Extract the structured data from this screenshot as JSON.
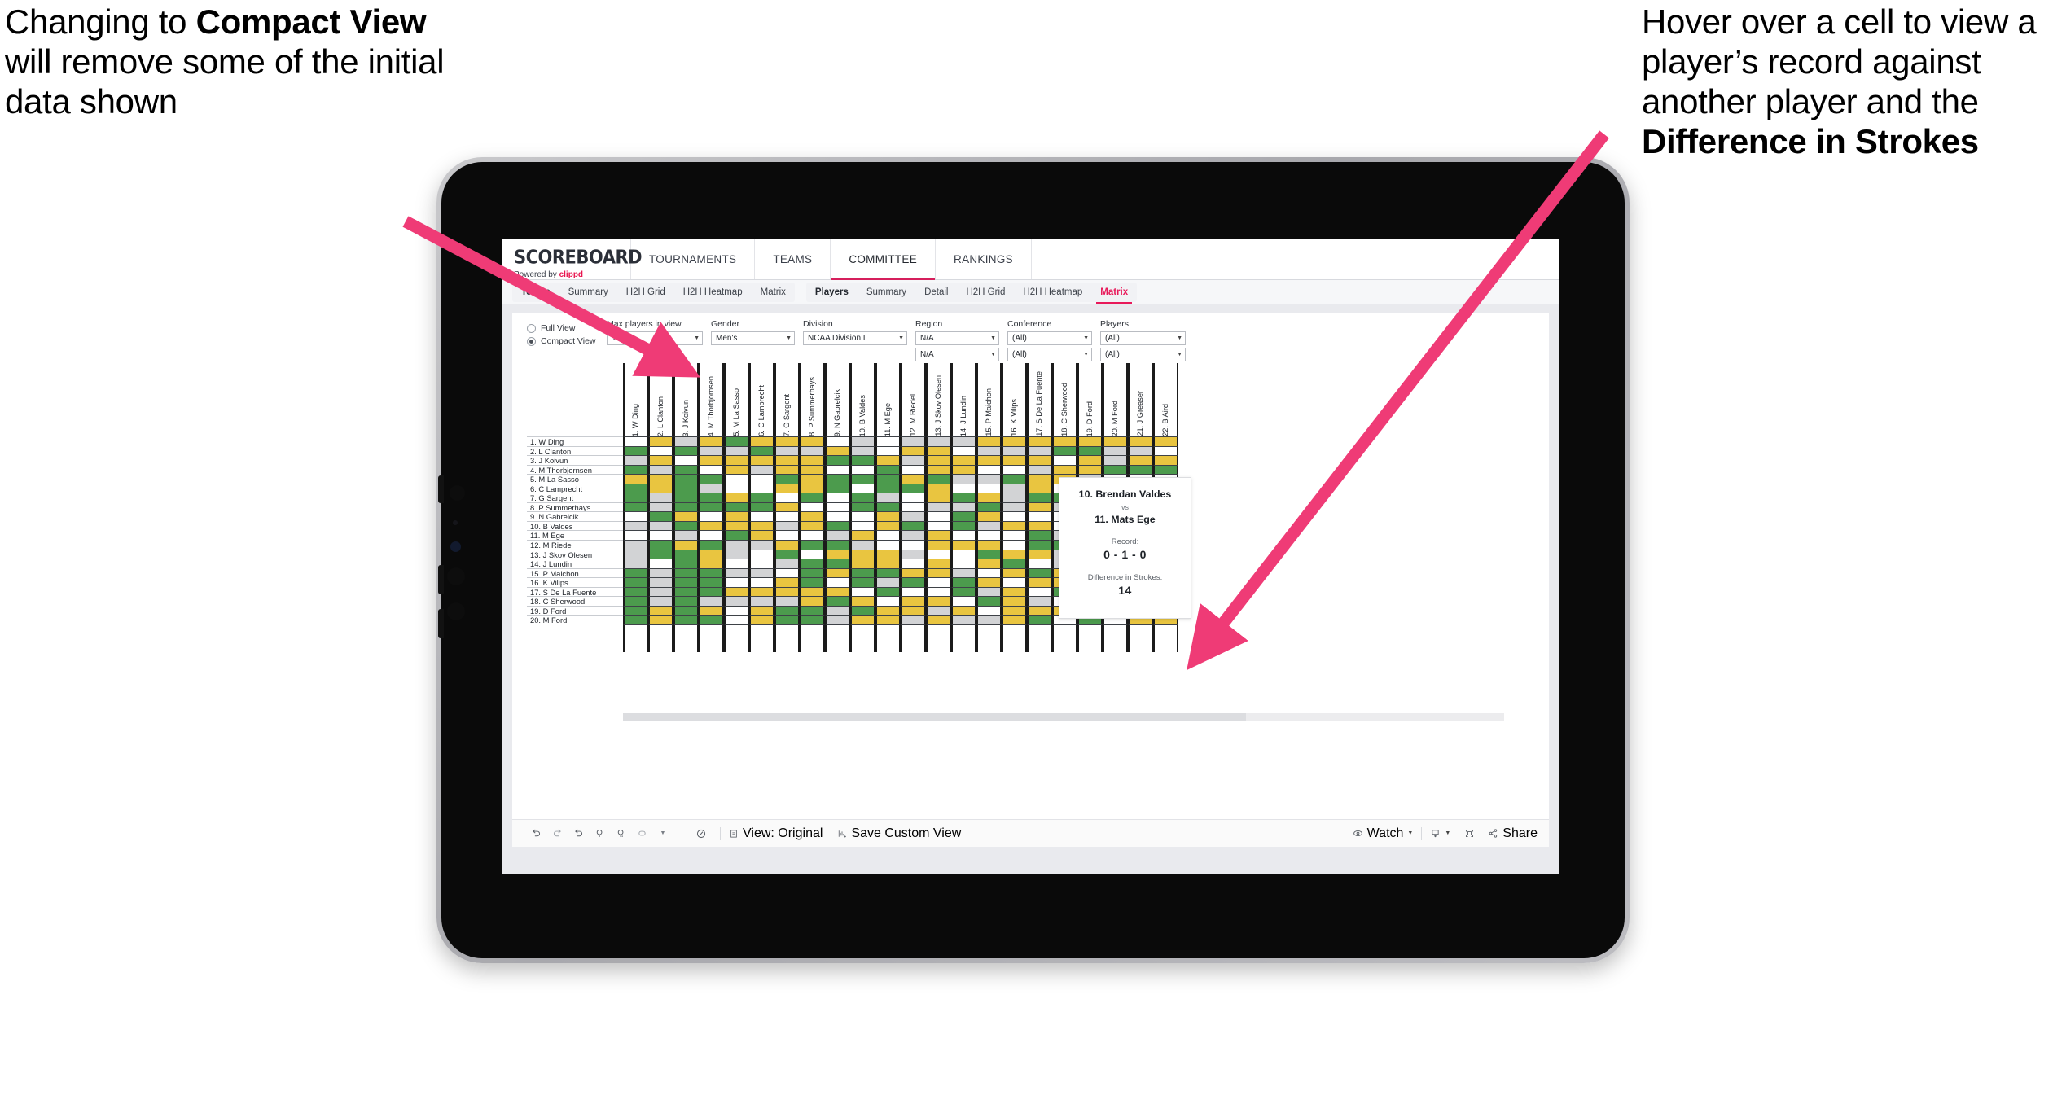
{
  "annotations": {
    "left": {
      "pre": "Changing to ",
      "bold": "Compact View",
      "post": " will remove some of the initial data shown"
    },
    "right": {
      "pre": "Hover over a cell to view a player’s record against another player and the ",
      "bold": "Difference in Strokes",
      "post": ""
    }
  },
  "app": {
    "logo": {
      "word": "SCOREBOARD",
      "sub_pre": "Powered by ",
      "sub_brand": "clippd"
    },
    "topnav": [
      {
        "label": "TOURNAMENTS",
        "active": false
      },
      {
        "label": "TEAMS",
        "active": false
      },
      {
        "label": "COMMITTEE",
        "active": true
      },
      {
        "label": "RANKINGS",
        "active": false
      }
    ],
    "subnav": {
      "group_teams": [
        "Teams",
        "Summary",
        "H2H Grid",
        "H2H Heatmap",
        "Matrix"
      ],
      "group_players": [
        "Players",
        "Summary",
        "Detail",
        "H2H Grid",
        "H2H Heatmap",
        "Matrix"
      ],
      "selected": "Matrix"
    }
  },
  "filters": {
    "view_options": [
      {
        "label": "Full View",
        "selected": false
      },
      {
        "label": "Compact View",
        "selected": true
      }
    ],
    "fields": [
      {
        "label": "Max players in view",
        "values": [
          "Top 25"
        ]
      },
      {
        "label": "Gender",
        "values": [
          "Men's"
        ]
      },
      {
        "label": "Division",
        "values": [
          "NCAA Division I"
        ]
      },
      {
        "label": "Region",
        "values": [
          "N/A",
          "N/A"
        ]
      },
      {
        "label": "Conference",
        "values": [
          "(All)",
          "(All)"
        ]
      },
      {
        "label": "Players",
        "values": [
          "(All)",
          "(All)"
        ]
      }
    ]
  },
  "matrix": {
    "columns": [
      "1. W Ding",
      "2. L Clanton",
      "3. J Koivun",
      "4. M Thorbjornsen",
      "5. M La Sasso",
      "6. C Lamprecht",
      "7. G Sargent",
      "8. P Summerhays",
      "9. N Gabrelcik",
      "10. B Valdes",
      "11. M Ege",
      "12. M Riedel",
      "13. J Skov Olesen",
      "14. J Lundin",
      "15. P Maichon",
      "16. K Vilips",
      "17. S De La Fuente",
      "18. C Sherwood",
      "19. D Ford",
      "20. M Ford",
      "21. J Greaser",
      "22. B Aird"
    ],
    "rows": [
      "1. W Ding",
      "2. L Clanton",
      "3. J Koivun",
      "4. M Thorbjornsen",
      "5. M La Sasso",
      "6. C Lamprecht",
      "7. G Sargent",
      "8. P Summerhays",
      "9. N Gabrelcik",
      "10. B Valdes",
      "11. M Ege",
      "12. M Riedel",
      "13. J Skov Olesen",
      "14. J Lundin",
      "15. P Maichon",
      "16. K Vilips",
      "17. S De La Fuente",
      "18. C Sherwood",
      "19. D Ford",
      "20. M Ford"
    ],
    "legend_colors": {
      "win": "#4c9b4d",
      "tie": "#e9c540",
      "loss": "#d2d3d5",
      "none": "#ffffff"
    },
    "cells": [
      [
        "w",
        "y",
        "s",
        "y",
        "g",
        "y",
        "y",
        "y",
        "w",
        "s",
        "w",
        "s",
        "s",
        "s",
        "y",
        "y",
        "y",
        "y",
        "y",
        "y",
        "y",
        "y"
      ],
      [
        "g",
        "w",
        "g",
        "s",
        "s",
        "g",
        "s",
        "s",
        "y",
        "s",
        "w",
        "y",
        "y",
        "w",
        "s",
        "s",
        "s",
        "g",
        "g",
        "s",
        "s",
        "w"
      ],
      [
        "s",
        "y",
        "w",
        "y",
        "y",
        "y",
        "y",
        "y",
        "g",
        "g",
        "y",
        "s",
        "y",
        "y",
        "y",
        "y",
        "y",
        "w",
        "y",
        "s",
        "y",
        "y"
      ],
      [
        "g",
        "s",
        "g",
        "w",
        "y",
        "s",
        "y",
        "y",
        "w",
        "w",
        "g",
        "w",
        "y",
        "y",
        "w",
        "w",
        "s",
        "y",
        "y",
        "g",
        "g",
        "g"
      ],
      [
        "y",
        "y",
        "g",
        "g",
        "w",
        "w",
        "g",
        "y",
        "g",
        "g",
        "g",
        "y",
        "g",
        "s",
        "s",
        "g",
        "y",
        "y",
        "s",
        "w",
        "w",
        "w"
      ],
      [
        "g",
        "y",
        "g",
        "s",
        "w",
        "w",
        "y",
        "y",
        "g",
        "w",
        "g",
        "g",
        "y",
        "w",
        "w",
        "s",
        "y",
        "w",
        "y",
        "y",
        "y",
        "y"
      ],
      [
        "g",
        "s",
        "g",
        "g",
        "y",
        "g",
        "w",
        "g",
        "w",
        "g",
        "s",
        "w",
        "y",
        "g",
        "y",
        "s",
        "g",
        "g",
        "g",
        "y",
        "s",
        "s"
      ],
      [
        "g",
        "s",
        "g",
        "g",
        "g",
        "g",
        "y",
        "w",
        "w",
        "g",
        "g",
        "w",
        "s",
        "s",
        "g",
        "s",
        "y",
        "s",
        "g",
        "g",
        "g",
        "g"
      ],
      [
        "w",
        "g",
        "y",
        "w",
        "y",
        "w",
        "w",
        "y",
        "w",
        "w",
        "y",
        "s",
        "w",
        "g",
        "y",
        "w",
        "w",
        "w",
        "w",
        "y",
        "y",
        "y"
      ],
      [
        "s",
        "s",
        "g",
        "y",
        "y",
        "y",
        "s",
        "y",
        "g",
        "w",
        "y",
        "g",
        "w",
        "g",
        "s",
        "y",
        "y",
        "w",
        "g",
        "y",
        "y",
        "y"
      ],
      [
        "w",
        "w",
        "s",
        "w",
        "g",
        "y",
        "w",
        "w",
        "s",
        "y",
        "w",
        "s",
        "y",
        "w",
        "w",
        "w",
        "g",
        "s",
        "y",
        "y",
        "y",
        "y"
      ],
      [
        "s",
        "g",
        "y",
        "g",
        "s",
        "s",
        "y",
        "g",
        "g",
        "s",
        "w",
        "w",
        "y",
        "y",
        "y",
        "w",
        "g",
        "g",
        "s",
        "y",
        "g",
        "y"
      ],
      [
        "s",
        "g",
        "g",
        "y",
        "s",
        "w",
        "g",
        "w",
        "y",
        "y",
        "y",
        "s",
        "w",
        "w",
        "g",
        "y",
        "y",
        "s",
        "g",
        "y",
        "w",
        "s"
      ],
      [
        "s",
        "w",
        "g",
        "y",
        "w",
        "w",
        "s",
        "g",
        "g",
        "y",
        "y",
        "w",
        "y",
        "w",
        "y",
        "g",
        "w",
        "s",
        "g",
        "g",
        "y",
        "g"
      ],
      [
        "g",
        "s",
        "g",
        "g",
        "s",
        "s",
        "w",
        "g",
        "y",
        "g",
        "g",
        "y",
        "y",
        "s",
        "w",
        "y",
        "g",
        "y",
        "w",
        "y",
        "y",
        "s"
      ],
      [
        "g",
        "s",
        "g",
        "g",
        "w",
        "w",
        "y",
        "g",
        "w",
        "g",
        "s",
        "g",
        "w",
        "g",
        "y",
        "w",
        "y",
        "y",
        "s",
        "g",
        "g",
        "s"
      ],
      [
        "g",
        "s",
        "g",
        "g",
        "y",
        "y",
        "y",
        "y",
        "y",
        "w",
        "g",
        "w",
        "w",
        "g",
        "s",
        "y",
        "w",
        "g",
        "y",
        "w",
        "s",
        "y"
      ],
      [
        "g",
        "s",
        "g",
        "s",
        "s",
        "s",
        "s",
        "y",
        "g",
        "y",
        "w",
        "y",
        "y",
        "w",
        "g",
        "y",
        "s",
        "w",
        "y",
        "g",
        "s",
        "g"
      ],
      [
        "g",
        "y",
        "g",
        "y",
        "w",
        "y",
        "g",
        "g",
        "s",
        "g",
        "y",
        "y",
        "s",
        "y",
        "w",
        "y",
        "y",
        "y",
        "w",
        "g",
        "g",
        "y"
      ],
      [
        "g",
        "y",
        "g",
        "g",
        "w",
        "y",
        "g",
        "g",
        "s",
        "y",
        "y",
        "s",
        "y",
        "s",
        "s",
        "y",
        "g",
        "w",
        "g",
        "w",
        "y",
        "y"
      ]
    ]
  },
  "tooltip": {
    "player_a": "10. Brendan Valdes",
    "vs": "vs",
    "player_b": "11. Mats Ege",
    "record_label": "Record:",
    "record_value": "0 - 1 - 0",
    "strokes_label": "Difference in Strokes:",
    "strokes_value": "14"
  },
  "toolbar": {
    "left_icons": [
      "undo-icon",
      "redo-icon",
      "revert-icon",
      "refresh-data-icon",
      "pause-auto-update-icon",
      "stop-shape-icon",
      "shape-dropdown-caret-icon"
    ],
    "history_icon": "highlight-icon",
    "view_label": "View: Original",
    "save_label": "Save Custom View",
    "watch_label": "Watch",
    "share_label": "Share",
    "download_icon": "download-icon",
    "fullscreen_icon": "fullscreen-icon",
    "share_icon": "share-icon"
  },
  "colors": {
    "brand_pink": "#e8195a",
    "accent_underline": "#d61f5c",
    "arrow": "#ef3b76"
  }
}
